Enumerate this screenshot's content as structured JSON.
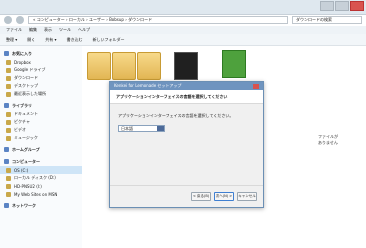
{
  "window": {
    "address": "« コンピューター › ローカル › ユーザー › Bobsup › ダウンロード",
    "search_placeholder": "ダウンロードの検索"
  },
  "menubar": {
    "items": [
      "ファイル",
      "編集",
      "表示",
      "ツール",
      "ヘルプ"
    ]
  },
  "toolbar": {
    "items": [
      "整理 ▾",
      "開く",
      "共有 ▾",
      "書き込む",
      "新しいフォルダー"
    ]
  },
  "sidebar": {
    "favorites_title": "お気に入り",
    "favorites": [
      "Dropbox",
      "Google ドライブ",
      "ダウンロード",
      "デスクトップ",
      "最近表示した場所"
    ],
    "libraries_title": "ライブラリ",
    "libraries": [
      "ドキュメント",
      "ピクチャ",
      "ビデオ",
      "ミュージック"
    ],
    "homegroup": "ホームグループ",
    "computer_title": "コンピューター",
    "computer_items": [
      "OS (C:)",
      "ローカル ディスク (D:)",
      "HD-PNSU2 (I:)",
      "My Web Sites on MSN"
    ],
    "network": "ネットワーク"
  },
  "right_note": "ファイルが\nありません",
  "dialog": {
    "title": "Kenkei for Lemonade セットアップ",
    "header": "アプリケーションインターフェイスの言語を選択してください",
    "prompt": "アプリケーションインターフェイスの言語を選択してください。",
    "selected_language": "日本語",
    "buttons": {
      "back": "< 戻る(B)",
      "next": "次へ(N) >",
      "cancel": "キャンセル"
    }
  }
}
